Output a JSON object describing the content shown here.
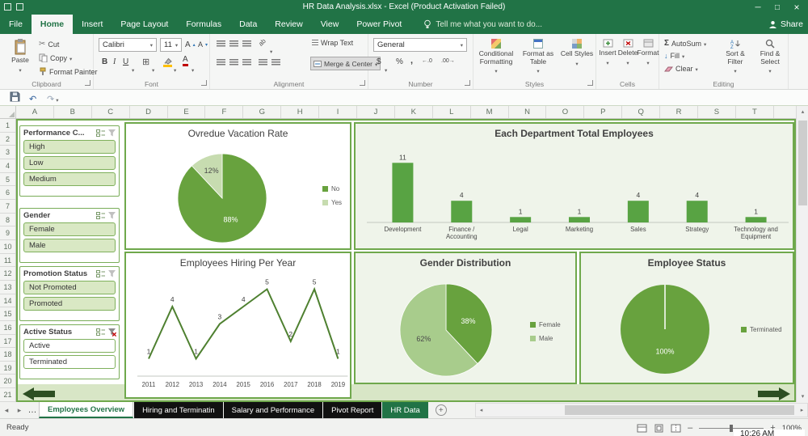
{
  "title_bar": {
    "title": "HR Data Analysis.xlsx - Excel (Product Activation Failed)"
  },
  "ribbon_tabs": {
    "file": "File",
    "tabs": [
      "Home",
      "Insert",
      "Page Layout",
      "Formulas",
      "Data",
      "Review",
      "View",
      "Power Pivot"
    ],
    "active": "Home",
    "tell_me": "Tell me what you want to do...",
    "share": "Share"
  },
  "ribbon": {
    "clipboard": {
      "label": "Clipboard",
      "paste": "Paste",
      "cut": "Cut",
      "copy": "Copy",
      "format_painter": "Format Painter"
    },
    "font": {
      "label": "Font",
      "font_name": "Calibri",
      "font_size": "11"
    },
    "alignment": {
      "label": "Alignment",
      "wrap_text": "Wrap Text",
      "merge_center": "Merge & Center"
    },
    "number": {
      "label": "Number",
      "format": "General"
    },
    "styles": {
      "label": "Styles",
      "conditional": "Conditional Formatting",
      "format_table": "Format as Table",
      "cell_styles": "Cell Styles"
    },
    "cells": {
      "label": "Cells",
      "insert": "Insert",
      "delete": "Delete",
      "format": "Format"
    },
    "editing": {
      "label": "Editing",
      "autosum": "AutoSum",
      "fill": "Fill",
      "clear": "Clear",
      "sort_filter": "Sort & Filter",
      "find_select": "Find & Select"
    }
  },
  "quick_access": {
    "buttons": [
      "Save",
      "Undo",
      "Redo"
    ]
  },
  "grid": {
    "columns": [
      "A",
      "B",
      "C",
      "D",
      "E",
      "F",
      "G",
      "H",
      "I",
      "J",
      "K",
      "L",
      "M",
      "N",
      "O",
      "P",
      "Q",
      "R",
      "S",
      "T"
    ],
    "rows": [
      "1",
      "2",
      "3",
      "4",
      "5",
      "6",
      "7",
      "8",
      "9",
      "10",
      "11",
      "12",
      "13",
      "14",
      "15",
      "16",
      "17",
      "18",
      "19",
      "20",
      "21"
    ]
  },
  "slicers": [
    {
      "title": "Performance C...",
      "filtered": false,
      "items": [
        {
          "label": "High",
          "selected": true
        },
        {
          "label": "Low",
          "selected": true
        },
        {
          "label": "Medium",
          "selected": true
        }
      ]
    },
    {
      "title": "Gender",
      "filtered": false,
      "items": [
        {
          "label": "Female",
          "selected": true
        },
        {
          "label": "Male",
          "selected": true
        }
      ]
    },
    {
      "title": "Promotion Status",
      "filtered": false,
      "items": [
        {
          "label": "Not Promoted",
          "selected": true
        },
        {
          "label": "Promoted",
          "selected": true
        }
      ]
    },
    {
      "title": "Active Status",
      "filtered": true,
      "items": [
        {
          "label": "Active",
          "selected": false
        },
        {
          "label": "Terminated",
          "selected": false
        }
      ]
    }
  ],
  "chart_data": [
    {
      "id": "vacation",
      "type": "pie",
      "title": "Ovredue Vacation Rate",
      "bg": "#FFFFFF",
      "slices": [
        {
          "label": "No",
          "value": 88,
          "pct_label": "88%",
          "color": "#68A23E",
          "text_color": "#FFFFFF"
        },
        {
          "label": "Yes",
          "value": 12,
          "pct_label": "12%",
          "color": "#C7DCB0",
          "text_color": "#4A4A4A"
        }
      ],
      "legend_position": "right"
    },
    {
      "id": "departments",
      "type": "bar",
      "title": "Each Department Total Employees",
      "bg": "#EFF4EA",
      "categories": [
        "Development",
        "Finance /\nAccounting",
        "Legal",
        "Marketing",
        "Sales",
        "Strategy",
        "Technology and\nEquipment"
      ],
      "values": [
        11,
        4,
        1,
        1,
        4,
        4,
        1
      ],
      "bar_color": "#58A343",
      "ylim": [
        0,
        12
      ],
      "grid": false
    },
    {
      "id": "hiring",
      "type": "line",
      "title": "Employees Hiring Per Year",
      "bg": "#FFFFFF",
      "x": [
        "2011",
        "2012",
        "2013",
        "2014",
        "2015",
        "2016",
        "2017",
        "2018",
        "2019"
      ],
      "values": [
        1,
        4,
        1,
        3,
        4,
        5,
        2,
        5,
        1
      ],
      "line_color": "#4E8030",
      "ylim": [
        0,
        5
      ],
      "grid": false
    },
    {
      "id": "gender",
      "type": "pie",
      "title": "Gender Distribution",
      "bg": "#EFF4EA",
      "slices": [
        {
          "label": "Female",
          "value": 38,
          "pct_label": "38%",
          "color": "#68A23E",
          "text_color": "#FFFFFF"
        },
        {
          "label": "Male",
          "value": 62,
          "pct_label": "62%",
          "color": "#A8CC8C",
          "text_color": "#4A4A4A"
        }
      ],
      "legend_position": "right"
    },
    {
      "id": "status",
      "type": "pie",
      "title": "Employee Status",
      "bg": "#EFF4EA",
      "slices": [
        {
          "label": "Terminated",
          "value": 100,
          "pct_label": "100%",
          "color": "#68A23E",
          "text_color": "#FFFFFF"
        }
      ],
      "legend_position": "right"
    }
  ],
  "sheet_tabs": {
    "tabs": [
      {
        "name": "Employees Overview",
        "style": "active"
      },
      {
        "name": "Hiring and Terminatin",
        "style": "black"
      },
      {
        "name": "Salary and Performance",
        "style": "black"
      },
      {
        "name": "Pivot Report",
        "style": "black"
      },
      {
        "name": "HR Data",
        "style": "green"
      }
    ]
  },
  "status_bar": {
    "ready": "Ready",
    "zoom": "100%"
  },
  "clock": "10:26 AM",
  "icons": {
    "scroll_left": "◂",
    "scroll_right": "▸",
    "ellipsis": "…",
    "new_sheet": "+",
    "cut": "✂",
    "autosum": "Σ",
    "undo": "↶",
    "redo": "↷",
    "borders": "⊞",
    "caret": "▾"
  },
  "colors": {
    "excel_green": "#217346",
    "chart_green": "#68A23E",
    "chart_light_green": "#C7DCB0",
    "chart_mid_green": "#A8CC8C",
    "dashboard_bg": "#D8E6C6",
    "panel_border": "#6FA84C"
  }
}
